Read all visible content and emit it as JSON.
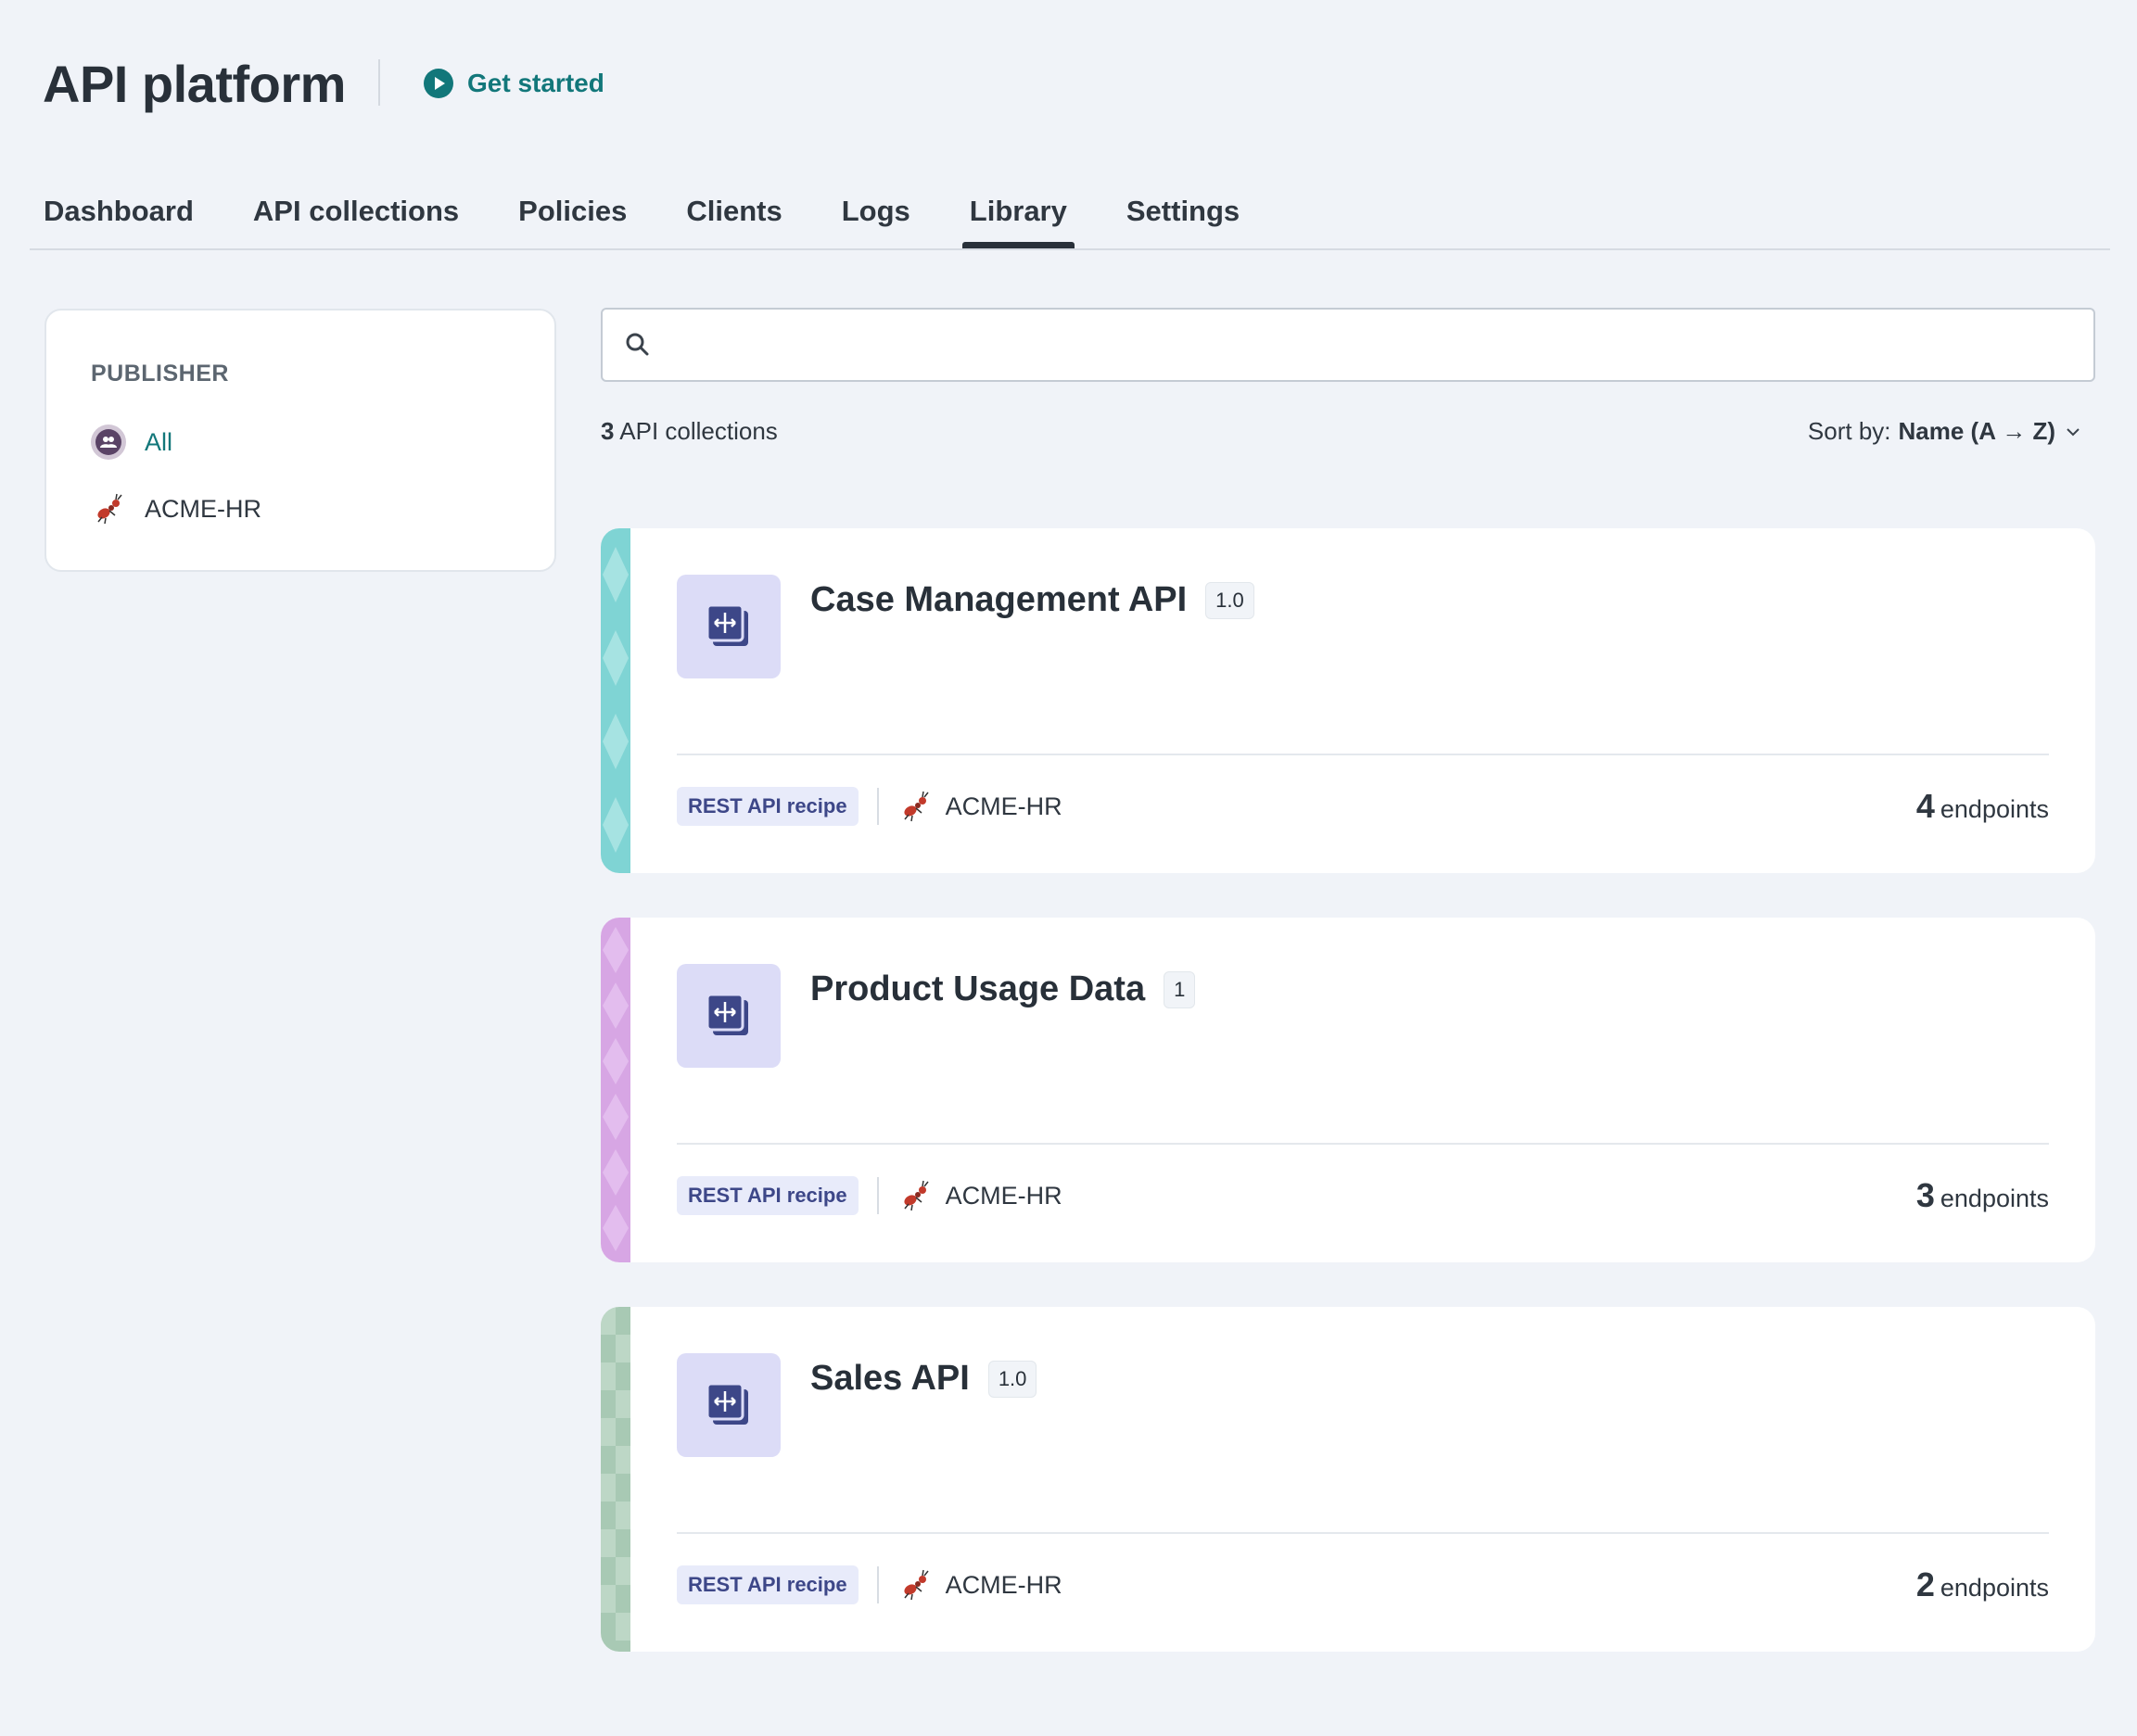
{
  "header": {
    "title": "API platform",
    "get_started_label": "Get started"
  },
  "tabs": [
    {
      "label": "Dashboard",
      "active": false
    },
    {
      "label": "API collections",
      "active": false
    },
    {
      "label": "Policies",
      "active": false
    },
    {
      "label": "Clients",
      "active": false
    },
    {
      "label": "Logs",
      "active": false
    },
    {
      "label": "Library",
      "active": true
    },
    {
      "label": "Settings",
      "active": false
    }
  ],
  "sidebar": {
    "heading": "PUBLISHER",
    "items": [
      {
        "label": "All",
        "icon": "people-icon",
        "selected": true
      },
      {
        "label": "ACME-HR",
        "icon": "ant-icon",
        "selected": false
      }
    ]
  },
  "search": {
    "value": "",
    "placeholder": ""
  },
  "results": {
    "count": "3",
    "count_label": "API collections",
    "sort_prefix": "Sort by:",
    "sort_value": "Name (A → Z)"
  },
  "cards": [
    {
      "title": "Case Management API",
      "version": "1.0",
      "tag": "REST API recipe",
      "publisher": "ACME-HR",
      "endpoints_count": "4",
      "endpoints_label": "endpoints",
      "accent": "#7fd4d4"
    },
    {
      "title": "Product Usage Data",
      "version": "1",
      "tag": "REST API recipe",
      "publisher": "ACME-HR",
      "endpoints_count": "3",
      "endpoints_label": "endpoints",
      "accent": "#d7a6e4"
    },
    {
      "title": "Sales API",
      "version": "1.0",
      "tag": "REST API recipe",
      "publisher": "ACME-HR",
      "endpoints_count": "2",
      "endpoints_label": "endpoints",
      "accent": "#a8c9b4"
    }
  ],
  "colors": {
    "background": "#f0f3f8",
    "link": "#12777a",
    "icon_box": "#dcdcf7",
    "icon_fg": "#3d4788",
    "tag_bg": "#e8ebfa"
  }
}
